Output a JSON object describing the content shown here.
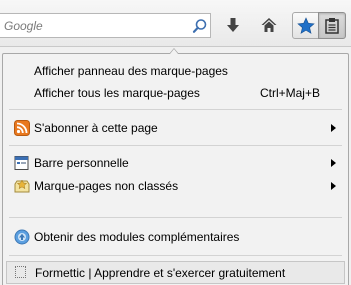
{
  "search": {
    "placeholder": "Google"
  },
  "icons": {
    "search": "magnifier-icon",
    "download": "download-arrow-icon",
    "home": "home-icon",
    "star": "bookmark-star-icon",
    "library": "bookmarks-library-icon"
  },
  "colors": {
    "star": "#1f6fc7",
    "rss": "#e9781e",
    "addons": "#5b9fe0"
  },
  "menu": {
    "show_sidebar": "Afficher panneau des marque-pages",
    "show_all": "Afficher tous les marque-pages",
    "show_all_shortcut": "Ctrl+Maj+B",
    "subscribe": "S'abonner à cette page",
    "toolbar": "Barre personnelle",
    "unsorted": "Marque-pages non classés",
    "addons": "Obtenir des modules complémentaires",
    "recent_bookmark": "Formettic | Apprendre et s'exercer gratuitement"
  }
}
